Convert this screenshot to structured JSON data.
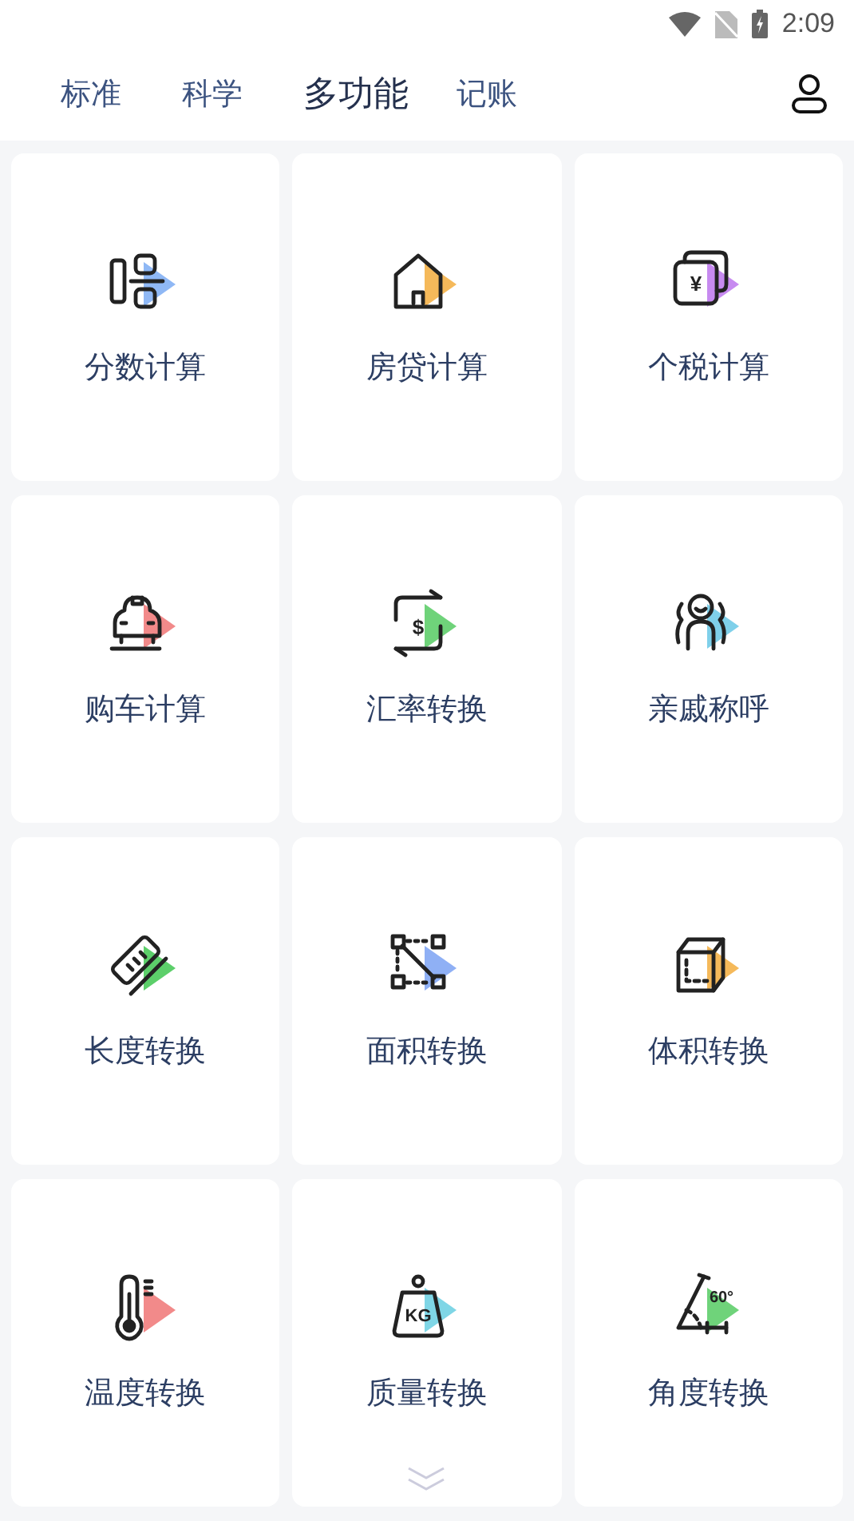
{
  "status_bar": {
    "time": "2:09"
  },
  "tabs": [
    {
      "label": "标准",
      "selected": false
    },
    {
      "label": "科学",
      "selected": false
    },
    {
      "label": "多功能",
      "selected": true
    },
    {
      "label": "记账",
      "selected": false
    }
  ],
  "tools": [
    {
      "label": "分数计算",
      "kind": "fraction",
      "color": "#8fb8f5"
    },
    {
      "label": "房贷计算",
      "kind": "house",
      "color": "#f5b95a"
    },
    {
      "label": "个税计算",
      "kind": "wallet",
      "color": "#c78af0",
      "badge": "¥"
    },
    {
      "label": "购车计算",
      "kind": "car",
      "color": "#f28a8a"
    },
    {
      "label": "汇率转换",
      "kind": "exchange",
      "color": "#6fd37a",
      "badge": "$"
    },
    {
      "label": "亲戚称呼",
      "kind": "people",
      "color": "#7fd0ea"
    },
    {
      "label": "长度转换",
      "kind": "ruler",
      "color": "#5ccf6a"
    },
    {
      "label": "面积转换",
      "kind": "area",
      "color": "#8fb0f5"
    },
    {
      "label": "体积转换",
      "kind": "cube",
      "color": "#f5b95a"
    },
    {
      "label": "温度转换",
      "kind": "thermo",
      "color": "#f28a8a"
    },
    {
      "label": "质量转换",
      "kind": "weight",
      "color": "#7fd6e6",
      "badge": "KG"
    },
    {
      "label": "角度转换",
      "kind": "angle",
      "color": "#6fd37a",
      "badge": "60°"
    }
  ]
}
